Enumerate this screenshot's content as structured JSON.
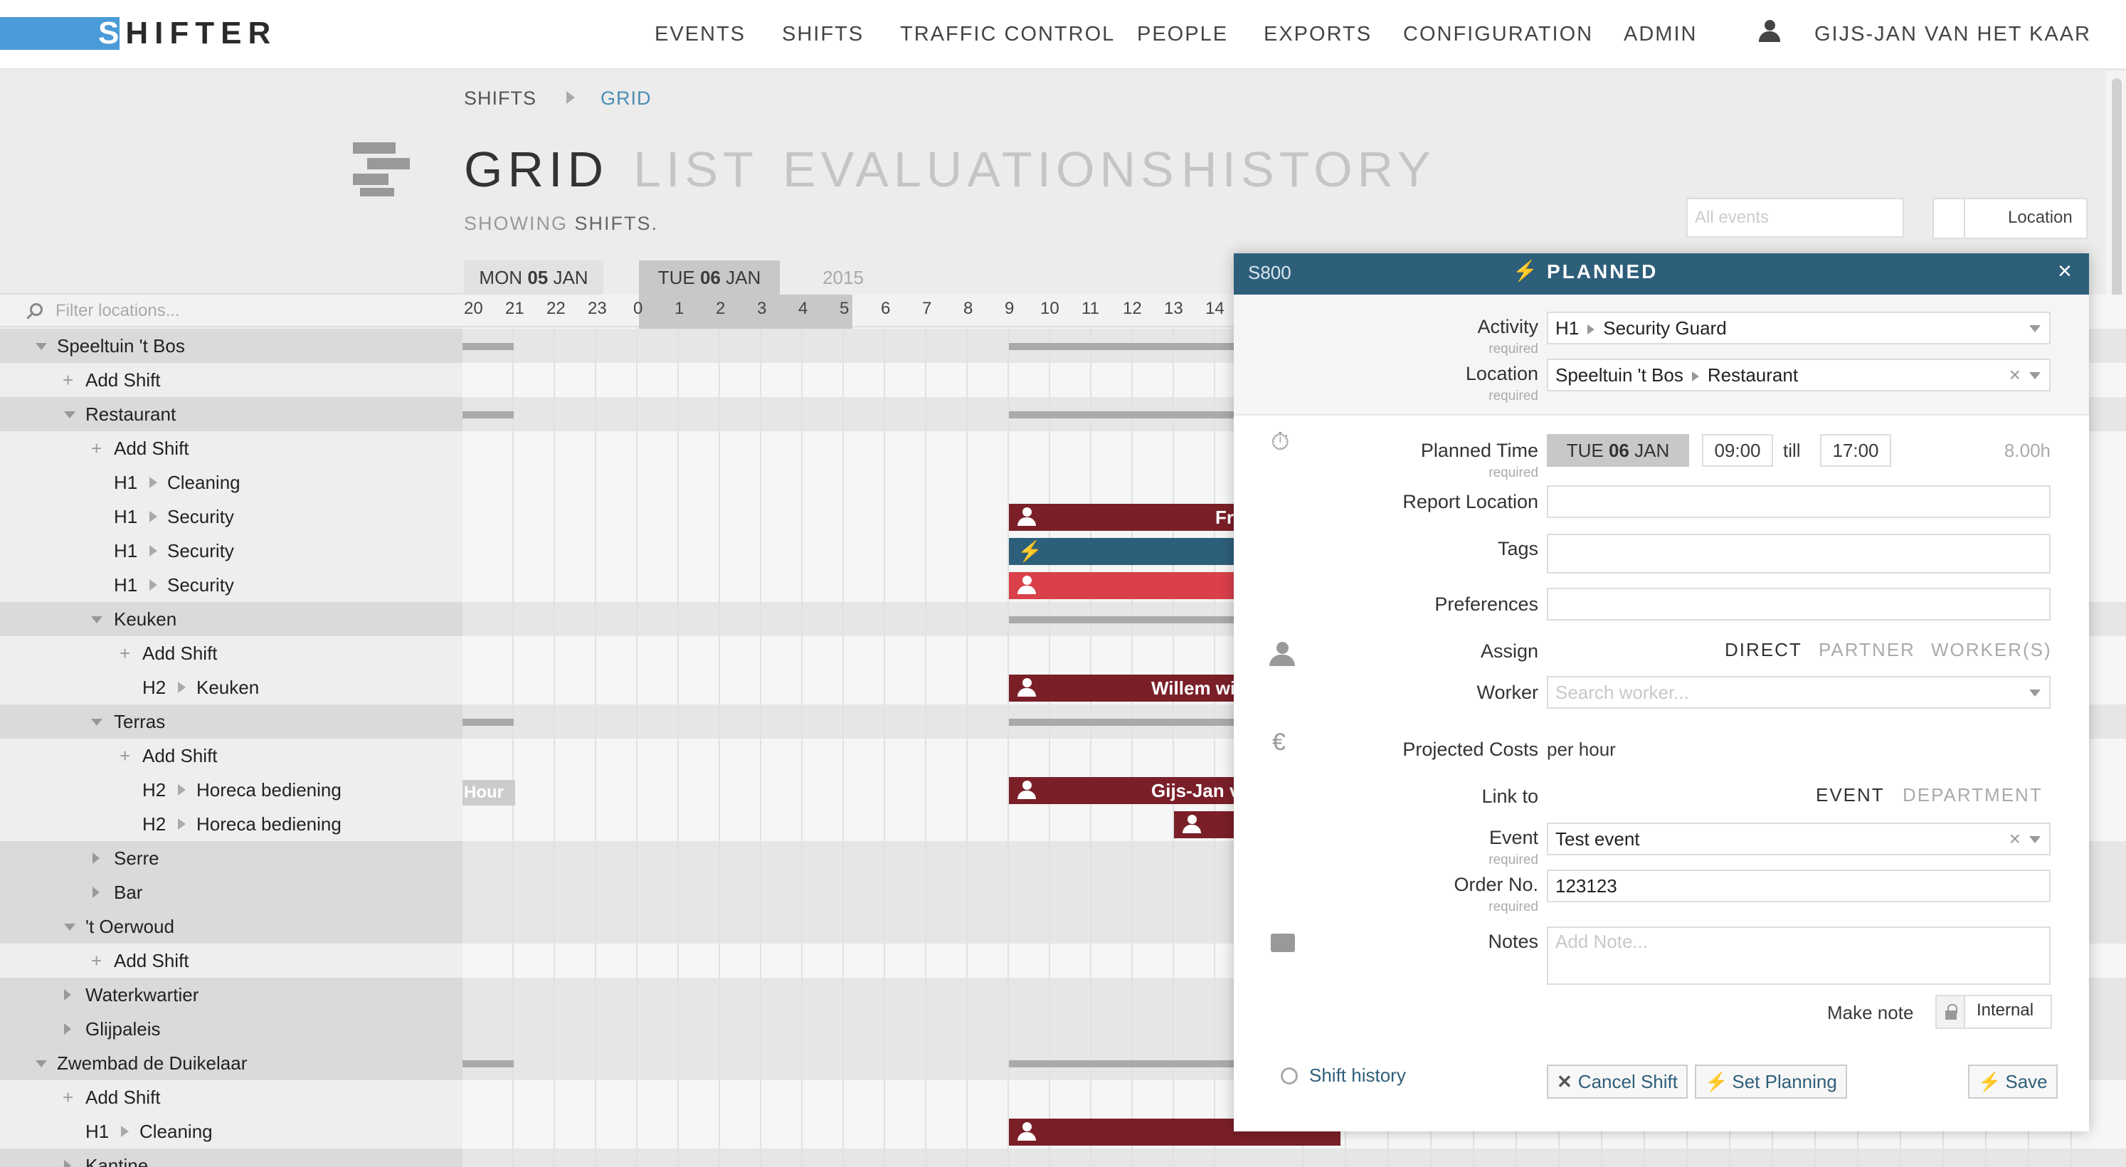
{
  "brand": {
    "logo_text": "SHIFTER",
    "accent": "#4a9bd8",
    "header_blue": "#2e5f7a",
    "planned_red": "#7a1f28",
    "alert_red": "#d9404a"
  },
  "nav": {
    "items": [
      "EVENTS",
      "SHIFTS",
      "TRAFFIC CONTROL",
      "PEOPLE",
      "EXPORTS",
      "CONFIGURATION",
      "ADMIN"
    ],
    "user": "GIJS-JAN VAN HET KAAR"
  },
  "breadcrumb": {
    "parent": "SHIFTS",
    "current": "GRID"
  },
  "tabs": [
    "GRID",
    "LIST",
    "EVALUATIONS",
    "HISTORY"
  ],
  "showing": {
    "prefix": "SHOWING",
    "value": "SHIFTS."
  },
  "filters": {
    "events_placeholder": "All events",
    "location_label": "Location"
  },
  "dates": {
    "mon": "MON",
    "mon_day": "05",
    "mon_month": "JAN",
    "tue": "TUE",
    "tue_day": "06",
    "tue_month": "JAN",
    "year": "2015"
  },
  "hours": [
    "20",
    "21",
    "22",
    "23",
    "0",
    "1",
    "2",
    "3",
    "4",
    "5",
    "6",
    "7",
    "8",
    "9",
    "10",
    "11",
    "12",
    "13",
    "14"
  ],
  "locations": {
    "filter_placeholder": "Filter locations...",
    "add_shift": "Add Shift",
    "rows": [
      "Speeltuin 't Bos",
      "Add Shift",
      "Restaurant",
      "Add Shift",
      "H1",
      "Cleaning",
      "H1",
      "Security",
      "H1",
      "Security",
      "H1",
      "Security",
      "Keuken",
      "Add Shift",
      "H2",
      "Keuken",
      "Terras",
      "Add Shift",
      "H2",
      "Horeca bediening",
      "H2",
      "Horeca bediening",
      "Serre",
      "Bar",
      "'t Oerwoud",
      "Add Shift",
      "Waterkwartier",
      "Glijpaleis",
      "Zwembad de Duikelaar",
      "Add Shift",
      "H1",
      "Cleaning",
      "Kantine"
    ]
  },
  "grid_shifts": {
    "s1": "Fri",
    "s4": "Willem wi",
    "s5": "Gijs-Jan v",
    "hour_label": "Hour"
  },
  "modal": {
    "id": "S800",
    "status": "PLANNED",
    "close": "×",
    "activity_label": "Activity",
    "required": "required",
    "activity_code": "H1",
    "activity_value": "Security Guard",
    "location_label": "Location",
    "location_parent": "Speeltuin 't Bos",
    "location_value": "Restaurant",
    "planned_time_label": "Planned Time",
    "date_day": "TUE",
    "date_num": "06",
    "date_month": "JAN",
    "start": "09:00",
    "till": "till",
    "end": "17:00",
    "duration": "8.00h",
    "report_location_label": "Report Location",
    "tags_label": "Tags",
    "preferences_label": "Preferences",
    "assign_label": "Assign",
    "assign_options": [
      "DIRECT",
      "PARTNER",
      "WORKER(S)"
    ],
    "worker_label": "Worker",
    "worker_placeholder": "Search worker...",
    "costs_label": "Projected Costs",
    "costs_value": "per hour",
    "link_label": "Link to",
    "link_options": [
      "EVENT",
      "DEPARTMENT"
    ],
    "event_label": "Event",
    "event_value": "Test event",
    "order_label": "Order No.",
    "order_value": "123123",
    "notes_label": "Notes",
    "notes_placeholder": "Add Note...",
    "make_note_label": "Make note",
    "internal_label": "Internal",
    "history_link": "Shift history",
    "cancel_label": "Cancel Shift",
    "set_planning_label": "Set Planning",
    "save_label": "Save"
  }
}
